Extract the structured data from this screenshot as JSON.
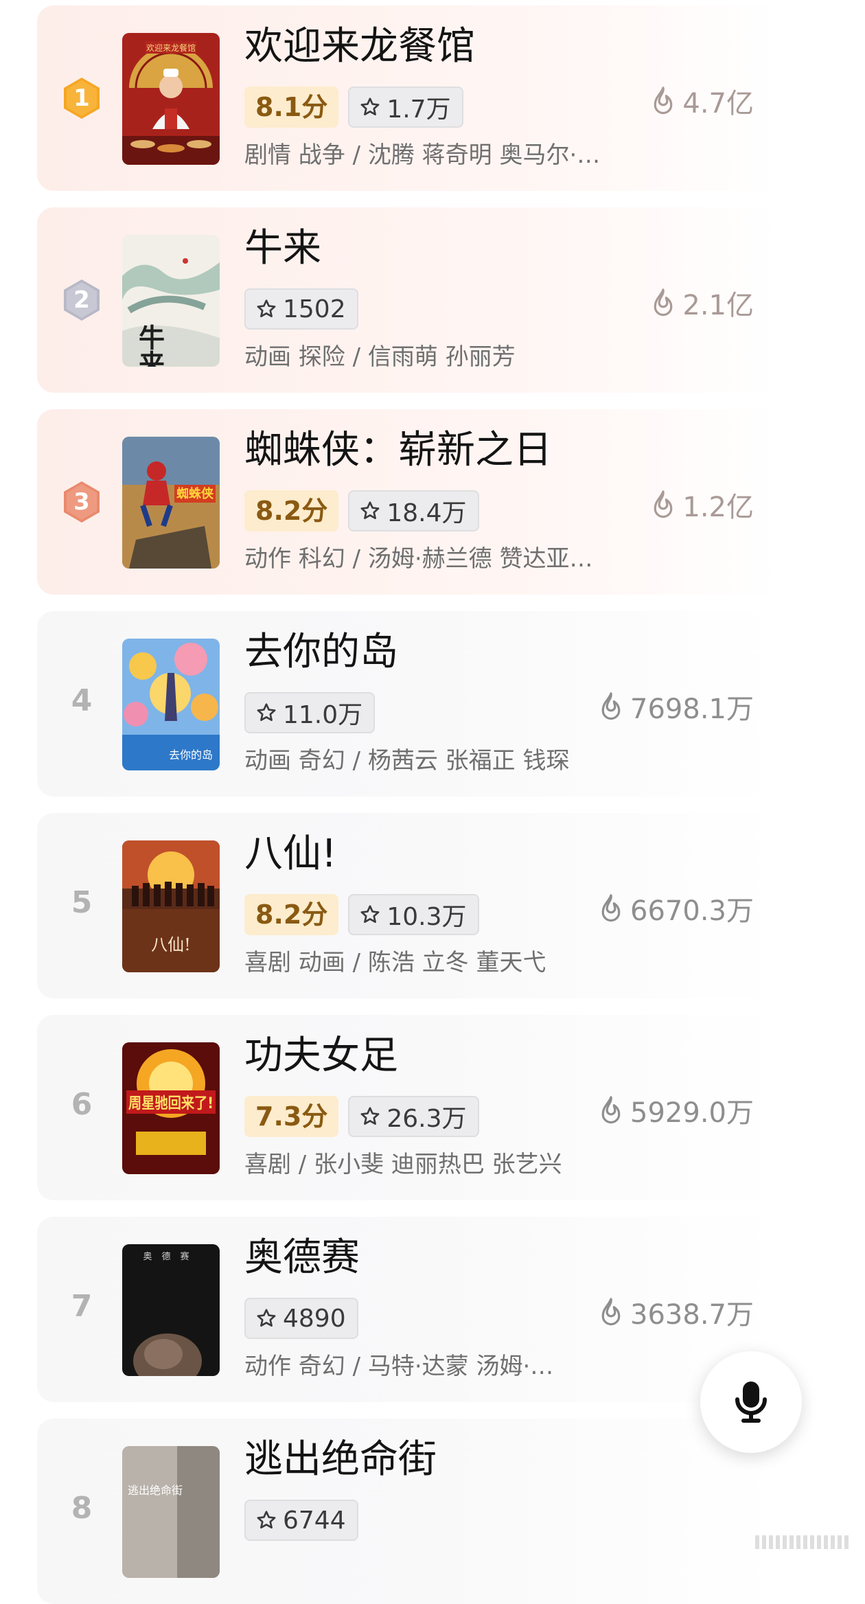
{
  "colors": {
    "gold": "#f5a623",
    "silver": "#b8b8c6",
    "bronze": "#e98a6e",
    "score_bg": "#fdeccd",
    "score_text": "#8a5a12"
  },
  "movies": [
    {
      "rank": "1",
      "title": "欢迎来龙餐馆",
      "score": "8.1分",
      "want": "1.7万",
      "meta": "剧情 战争 / 沈腾 蒋奇明 奥马尔·…",
      "heat": "4.7亿"
    },
    {
      "rank": "2",
      "title": "牛来",
      "score": "",
      "want": "1502",
      "meta": "动画 探险 / 信雨萌 孙丽芳",
      "heat": "2.1亿"
    },
    {
      "rank": "3",
      "title": "蜘蛛侠：崭新之日",
      "score": "8.2分",
      "want": "18.4万",
      "meta": "动作 科幻 / 汤姆·赫兰德 赞达亚…",
      "heat": "1.2亿"
    },
    {
      "rank": "4",
      "title": "去你的岛",
      "score": "",
      "want": "11.0万",
      "meta": "动画 奇幻 / 杨茜云 张福正 钱琛",
      "heat": "7698.1万"
    },
    {
      "rank": "5",
      "title": "八仙!",
      "score": "8.2分",
      "want": "10.3万",
      "meta": "喜剧 动画 / 陈浩 立冬 董天弋",
      "heat": "6670.3万"
    },
    {
      "rank": "6",
      "title": "功夫女足",
      "score": "7.3分",
      "want": "26.3万",
      "meta": "喜剧 / 张小斐 迪丽热巴 张艺兴",
      "heat": "5929.0万"
    },
    {
      "rank": "7",
      "title": "奥德赛",
      "score": "",
      "want": "4890",
      "meta": "动作 奇幻 / 马特·达蒙 汤姆·…",
      "heat": "3638.7万"
    },
    {
      "rank": "8",
      "title": "逃出绝命街",
      "score": "",
      "want": "6744",
      "meta": "",
      "heat": ""
    }
  ],
  "posters": [
    {
      "text": "欢迎来龙餐馆",
      "icon": "chef-poster-image"
    },
    {
      "text": "牛来",
      "icon": "ink-landscape-poster-image"
    },
    {
      "text": "蜘蛛侠",
      "icon": "spider-hero-poster-image"
    },
    {
      "text": "去你的岛",
      "icon": "island-poster-image"
    },
    {
      "text": "八仙!",
      "icon": "sunset-poster-image"
    },
    {
      "text": "周星驰回来了!",
      "icon": "kungfu-poster-image"
    },
    {
      "text": "奥德赛",
      "icon": "dark-poster-image"
    },
    {
      "text": "逃出绝命街",
      "icon": "street-poster-image"
    }
  ]
}
